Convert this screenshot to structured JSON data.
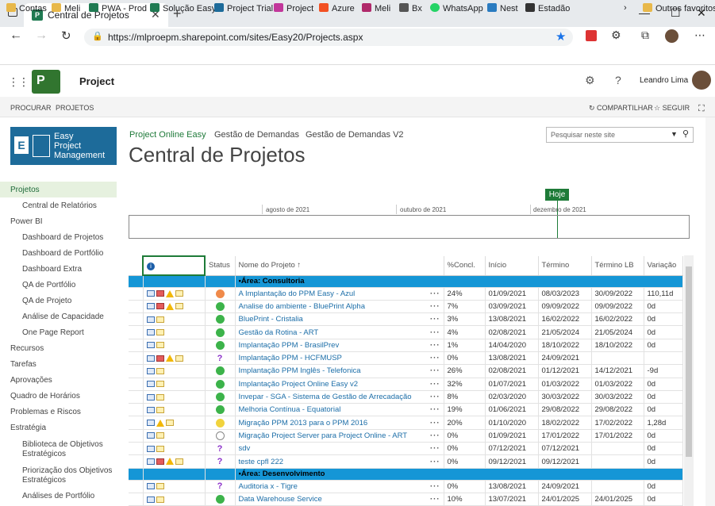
{
  "browser": {
    "tab_title": "Central de Projetos",
    "url": "https://mlproepm.sharepoint.com/sites/Easy20/Projects.aspx",
    "bookmarks": [
      "Contas",
      "Meli",
      "PWA - Prod",
      "Solução Easy",
      "Project Trial",
      "Project",
      "Azure",
      "Meli",
      "Bx",
      "WhatsApp",
      "Nest",
      "Estadão"
    ],
    "other_bookmarks": "Outros favoritos"
  },
  "suite": {
    "app": "Project",
    "user": "Leandro Lima"
  },
  "ribbon": {
    "procurar": "PROCURAR",
    "projetos": "PROJETOS",
    "compartilhar": "COMPARTILHAR",
    "seguir": "SEGUIR"
  },
  "brand": {
    "line1": "Easy",
    "line2": "Project",
    "line3": "Management"
  },
  "nav": {
    "items": [
      "Projetos",
      "Central de Relatórios",
      "Power BI",
      "Dashboard de Projetos",
      "Dashboard de Portfólio",
      "Dashboard Extra",
      "QA de Portfólio",
      "QA de Projeto",
      "Análise de Capacidade",
      "One Page Report",
      "Recursos",
      "Tarefas",
      "Aprovações",
      "Quadro de Horários",
      "Problemas e Riscos",
      "Estratégia",
      "Biblioteca de Objetivos Estratégicos",
      "Priorização dos Objetivos Estratégicos",
      "Análises de Portfólio"
    ]
  },
  "toplinks": [
    "Project Online Easy",
    "Gestão de Demandas",
    "Gestão de Demandas V2"
  ],
  "search_placeholder": "Pesquisar neste site",
  "page_title": "Central de Projetos",
  "timeline": {
    "today": "Hoje",
    "labels": [
      "agosto de 2021",
      "outubro de 2021",
      "dezembro de 2021"
    ]
  },
  "grid": {
    "headers": [
      "",
      "Status",
      "Nome do Projeto ↑",
      "%Concl.",
      "Início",
      "Término",
      "Término LB",
      "Variação"
    ],
    "groups": [
      {
        "label": "Área: Consultoria",
        "rows": [
          {
            "ind": "crwn",
            "st": "o",
            "name": "A Implantação do PPM Easy - Azul",
            "pct": "24%",
            "ini": "01/09/2021",
            "ter": "08/03/2023",
            "lb": "30/09/2022",
            "var": "110,11d"
          },
          {
            "ind": "crwn",
            "st": "g",
            "name": "Analise do ambiente - BluePrint Alpha",
            "pct": "7%",
            "ini": "03/09/2021",
            "ter": "09/09/2022",
            "lb": "09/09/2022",
            "var": "0d"
          },
          {
            "ind": "cn",
            "st": "g",
            "name": "BluePrint - Cristalia",
            "pct": "3%",
            "ini": "13/08/2021",
            "ter": "16/02/2022",
            "lb": "16/02/2022",
            "var": "0d"
          },
          {
            "ind": "cn",
            "st": "g",
            "name": "Gestão da Rotina - ART",
            "pct": "4%",
            "ini": "02/08/2021",
            "ter": "21/05/2024",
            "lb": "21/05/2024",
            "var": "0d"
          },
          {
            "ind": "cn",
            "st": "g",
            "name": "Implantação PPM - BrasilPrev",
            "pct": "1%",
            "ini": "14/04/2020",
            "ter": "18/10/2022",
            "lb": "18/10/2022",
            "var": "0d"
          },
          {
            "ind": "crwn",
            "st": "q",
            "name": "Implantação PPM - HCFMUSP",
            "pct": "0%",
            "ini": "13/08/2021",
            "ter": "24/09/2021",
            "lb": "",
            "var": ""
          },
          {
            "ind": "cn",
            "st": "g",
            "name": "Implantação PPM Inglês - Telefonica",
            "pct": "26%",
            "ini": "02/08/2021",
            "ter": "01/12/2021",
            "lb": "14/12/2021",
            "var": "-9d"
          },
          {
            "ind": "cn",
            "st": "g",
            "name": "Implantação Project Online Easy v2",
            "pct": "32%",
            "ini": "01/07/2021",
            "ter": "01/03/2022",
            "lb": "01/03/2022",
            "var": "0d"
          },
          {
            "ind": "cn",
            "st": "g",
            "name": "Invepar - SGA - Sistema de Gestão de Arrecadação",
            "pct": "8%",
            "ini": "02/03/2020",
            "ter": "30/03/2022",
            "lb": "30/03/2022",
            "var": "0d"
          },
          {
            "ind": "cn",
            "st": "g",
            "name": "Melhoria Contínua - Equatorial",
            "pct": "19%",
            "ini": "01/06/2021",
            "ter": "29/08/2022",
            "lb": "29/08/2022",
            "var": "0d"
          },
          {
            "ind": "cwn",
            "st": "y",
            "name": "Migração PPM 2013 para o PPM 2016",
            "pct": "20%",
            "ini": "01/10/2020",
            "ter": "18/02/2022",
            "lb": "17/02/2022",
            "var": "1,28d"
          },
          {
            "ind": "cn",
            "st": "e",
            "name": "Migração Project Server para Project Online - ART",
            "pct": "0%",
            "ini": "01/09/2021",
            "ter": "17/01/2022",
            "lb": "17/01/2022",
            "var": "0d"
          },
          {
            "ind": "cn",
            "st": "q",
            "name": "sdv",
            "pct": "0%",
            "ini": "07/12/2021",
            "ter": "07/12/2021",
            "lb": "",
            "var": "0d"
          },
          {
            "ind": "crwn",
            "st": "q",
            "name": "teste cpfl 222",
            "pct": "0%",
            "ini": "09/12/2021",
            "ter": "09/12/2021",
            "lb": "",
            "var": "0d"
          }
        ]
      },
      {
        "label": "Área: Desenvolvimento",
        "rows": [
          {
            "ind": "cn",
            "st": "q",
            "name": "Auditoria x - Tigre",
            "pct": "0%",
            "ini": "13/08/2021",
            "ter": "24/09/2021",
            "lb": "",
            "var": "0d"
          },
          {
            "ind": "cn",
            "st": "g",
            "name": "Data Warehouse Service",
            "pct": "10%",
            "ini": "13/07/2021",
            "ter": "24/01/2025",
            "lb": "24/01/2025",
            "var": "0d"
          }
        ]
      }
    ]
  }
}
